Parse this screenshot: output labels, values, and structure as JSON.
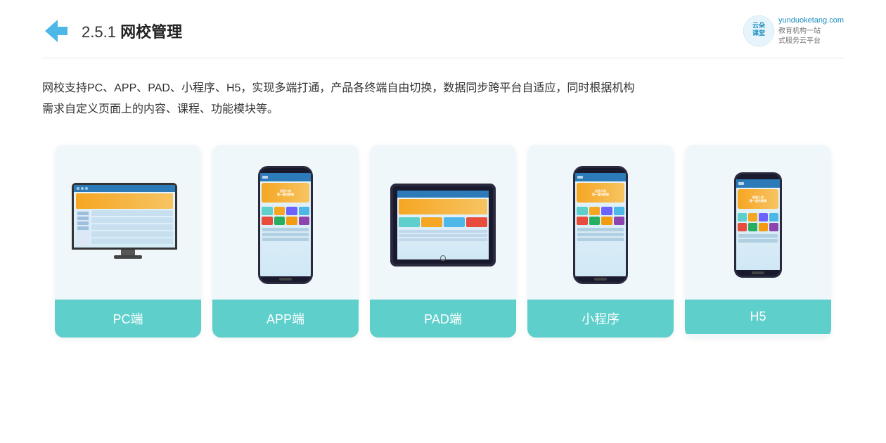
{
  "header": {
    "section_number": "2.5.1",
    "title_bold": "网校管理",
    "brand": {
      "site": "yunduoketang.com",
      "line1": "教育机构一站",
      "line2": "式服务云平台"
    }
  },
  "description": {
    "text": "网校支持PC、APP、PAD、小程序、H5，实现多端打通，产品各终端自由切换，数据同步跨平台自适应，同时根据机构",
    "text2": "需求自定义页面上的内容、课程、功能模块等。"
  },
  "cards": [
    {
      "id": "pc",
      "label": "PC端"
    },
    {
      "id": "app",
      "label": "APP端"
    },
    {
      "id": "pad",
      "label": "PAD端"
    },
    {
      "id": "miniapp",
      "label": "小程序"
    },
    {
      "id": "h5",
      "label": "H5"
    }
  ]
}
